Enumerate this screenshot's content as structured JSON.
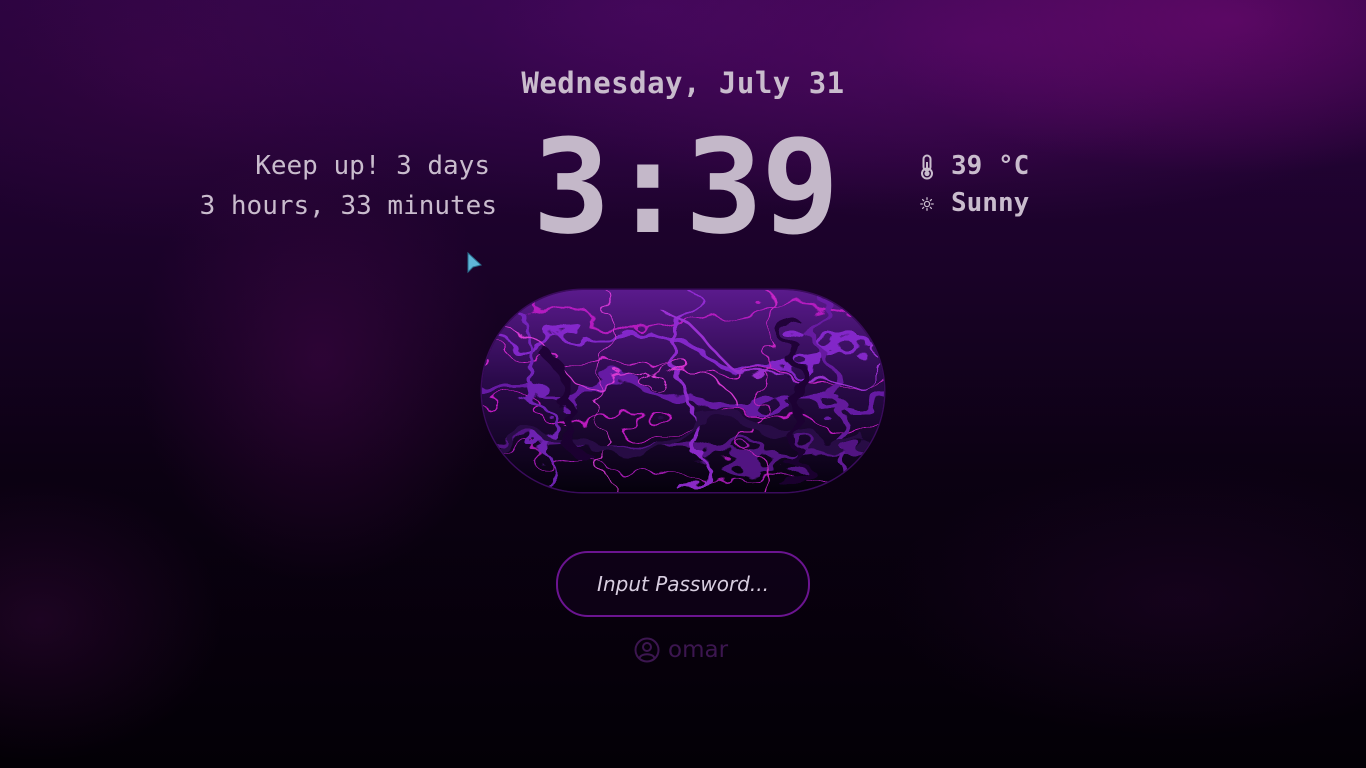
{
  "lockscreen": {
    "date": "Wednesday, July 31",
    "clock": "3:39",
    "uptime": {
      "line1": "Keep up! 3 days",
      "line2": "3 hours, 33 minutes"
    },
    "weather": {
      "temperature": "39 °C",
      "condition": "Sunny",
      "temperature_icon": "thermometer-icon",
      "condition_icon": "sun-icon"
    },
    "art_image": "fluid-marble-art",
    "password": {
      "placeholder": "Input Password...",
      "value": ""
    },
    "user": {
      "name": "omar",
      "icon": "user-circle-icon"
    }
  },
  "colors": {
    "text": "#c9bccd",
    "input_border": "#6b1490",
    "username": "#3c1650",
    "background": "#1a0228"
  }
}
